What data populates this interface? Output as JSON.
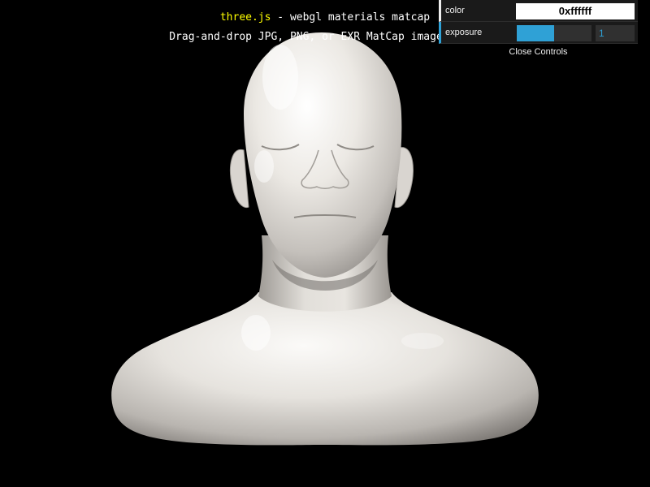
{
  "info": {
    "link_text": "three.js",
    "title_rest": " - webgl materials matcap",
    "subtitle": "Drag-and-drop JPG, PNG, or EXR MatCap image files"
  },
  "gui": {
    "color": {
      "label": "color",
      "value": "0xffffff"
    },
    "exposure": {
      "label": "exposure",
      "value": "1",
      "fill_fraction": 0.5
    },
    "close_label": "Close Controls"
  },
  "scene": {
    "background": "#000000",
    "model_tint": "#e8e5e0",
    "accent": "#2fa1d6"
  }
}
